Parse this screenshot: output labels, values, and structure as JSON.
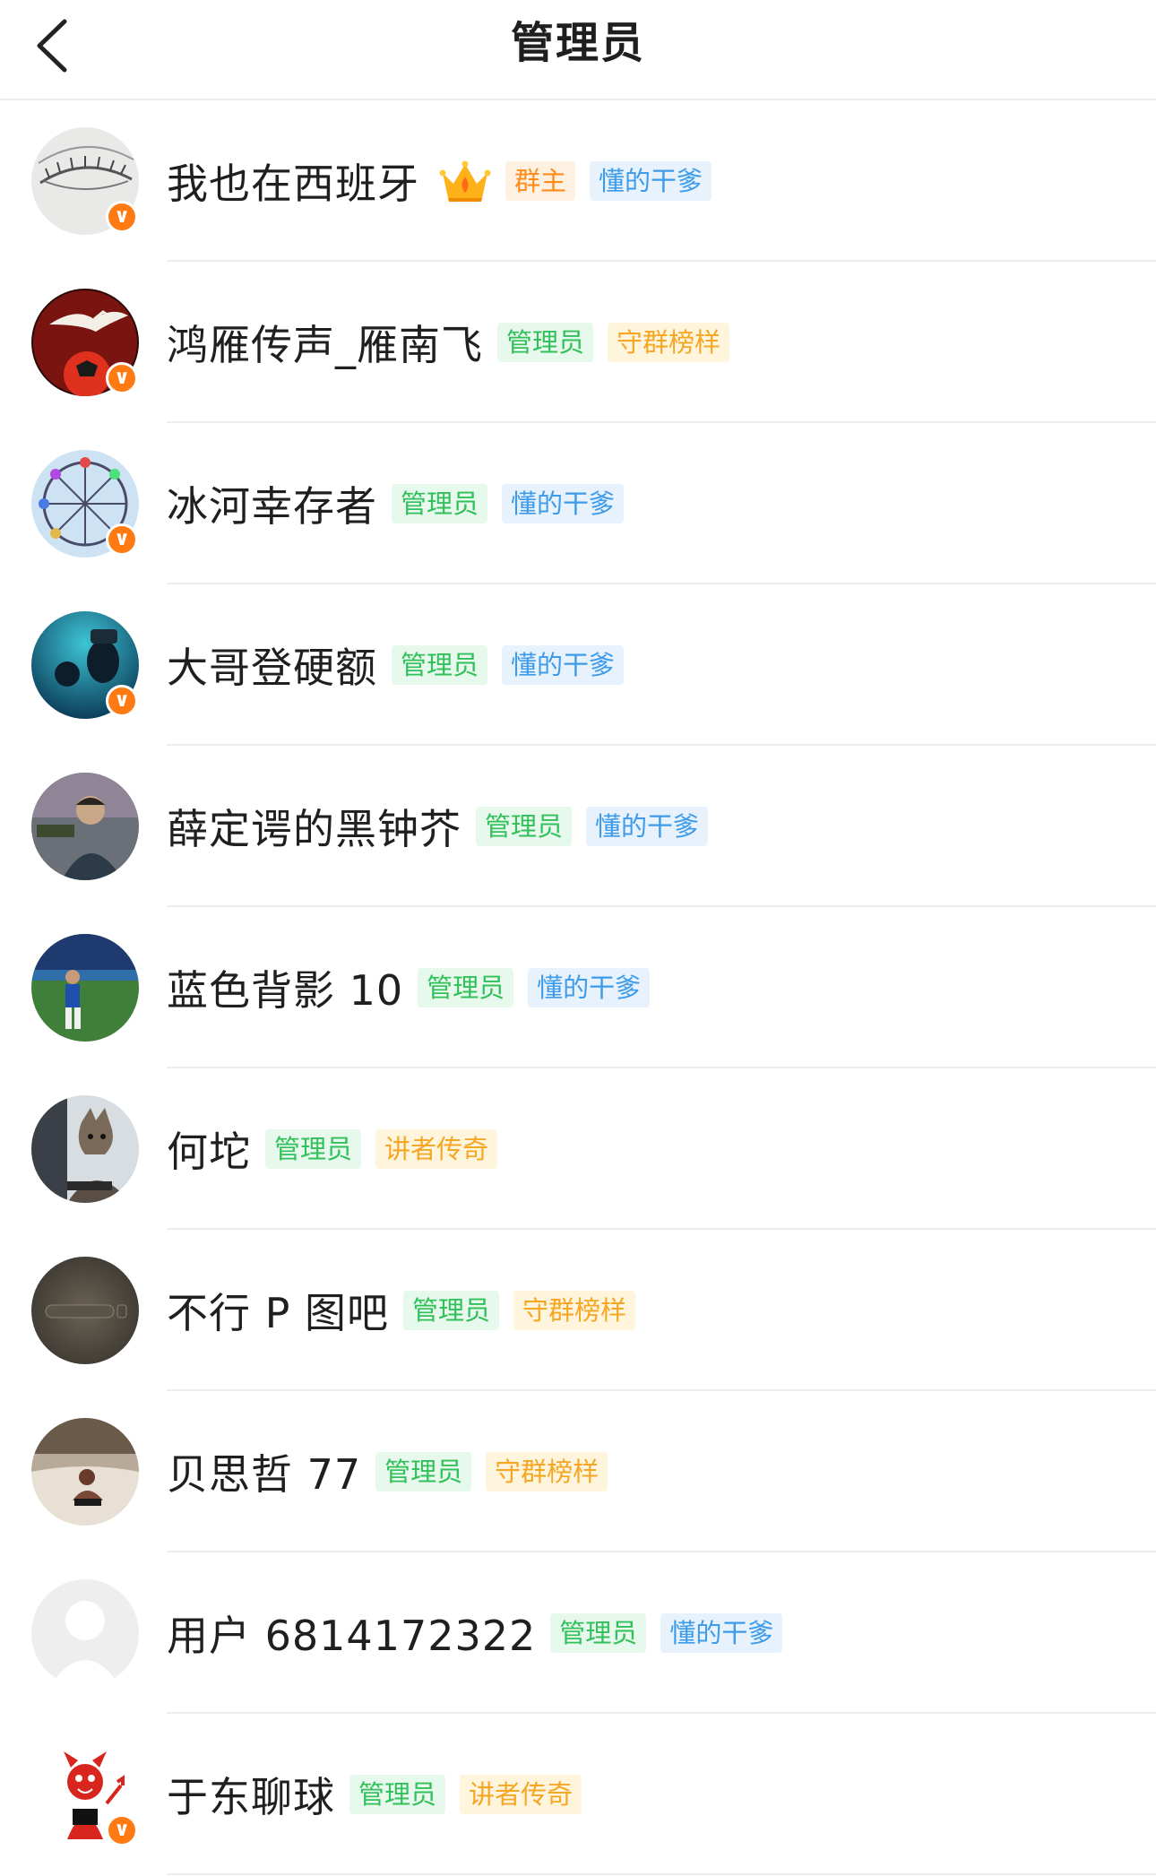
{
  "header": {
    "title": "管理员"
  },
  "members": [
    {
      "name": "我也在西班牙",
      "crown": true,
      "verified": true,
      "avatar": "eye-sketch",
      "tags": [
        {
          "label": "群主",
          "style": "owner"
        },
        {
          "label": "懂的干爹",
          "style": "blue"
        }
      ]
    },
    {
      "name": "鸿雁传声_雁南飞",
      "crown": false,
      "verified": true,
      "avatar": "goose-football",
      "tags": [
        {
          "label": "管理员",
          "style": "admin"
        },
        {
          "label": "守群榜样",
          "style": "orange"
        }
      ]
    },
    {
      "name": "冰河幸存者",
      "crown": false,
      "verified": true,
      "avatar": "ferris-wheel",
      "tags": [
        {
          "label": "管理员",
          "style": "admin"
        },
        {
          "label": "懂的干爹",
          "style": "blue"
        }
      ]
    },
    {
      "name": "大哥登硬额",
      "crown": false,
      "verified": true,
      "avatar": "underwater-diver",
      "tags": [
        {
          "label": "管理员",
          "style": "admin"
        },
        {
          "label": "懂的干爹",
          "style": "blue"
        }
      ]
    },
    {
      "name": "薛定谔的黑钟芥",
      "crown": false,
      "verified": false,
      "avatar": "man-portrait",
      "tags": [
        {
          "label": "管理员",
          "style": "admin"
        },
        {
          "label": "懂的干爹",
          "style": "blue"
        }
      ]
    },
    {
      "name": "蓝色背影 10",
      "crown": false,
      "verified": false,
      "avatar": "football-player",
      "tags": [
        {
          "label": "管理员",
          "style": "admin"
        },
        {
          "label": "懂的干爹",
          "style": "blue"
        }
      ]
    },
    {
      "name": "何坨",
      "crown": false,
      "verified": false,
      "avatar": "wolf-computer",
      "tags": [
        {
          "label": "管理员",
          "style": "admin"
        },
        {
          "label": "讲者传奇",
          "style": "orange"
        }
      ]
    },
    {
      "name": "不行 P 图吧",
      "crown": false,
      "verified": false,
      "avatar": "dark-screen",
      "tags": [
        {
          "label": "管理员",
          "style": "admin"
        },
        {
          "label": "守群榜样",
          "style": "orange"
        }
      ]
    },
    {
      "name": "贝思哲 77",
      "crown": false,
      "verified": false,
      "avatar": "beach-man",
      "tags": [
        {
          "label": "管理员",
          "style": "admin"
        },
        {
          "label": "守群榜样",
          "style": "orange"
        }
      ]
    },
    {
      "name": "用户 6814172322",
      "crown": false,
      "verified": false,
      "avatar": "default-user",
      "tags": [
        {
          "label": "管理员",
          "style": "admin"
        },
        {
          "label": "懂的干爹",
          "style": "blue"
        }
      ]
    },
    {
      "name": "于东聊球",
      "crown": false,
      "verified": true,
      "avatar": "red-devil",
      "tags": [
        {
          "label": "管理员",
          "style": "admin"
        },
        {
          "label": "讲者传奇",
          "style": "orange"
        }
      ]
    }
  ],
  "colors": {
    "owner_tag_bg": "#fff1e2",
    "owner_tag_text": "#ff8c1a",
    "admin_tag_bg": "#e7f8ec",
    "admin_tag_text": "#32c05a",
    "blue_tag_bg": "#e7f2fd",
    "blue_tag_text": "#3d9be9",
    "orange_tag_bg": "#fff5dc",
    "orange_tag_text": "#f5a623",
    "verified_badge": "#ff7a12"
  }
}
